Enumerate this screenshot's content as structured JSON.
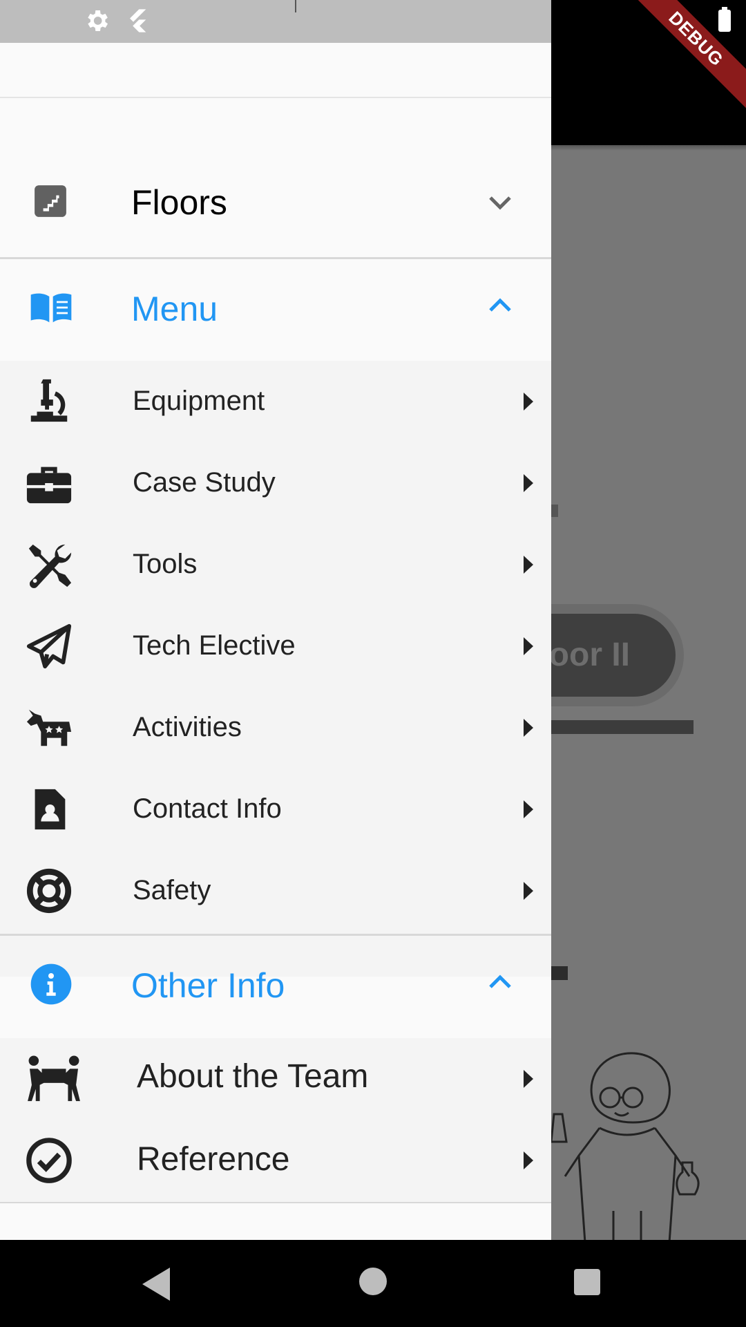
{
  "status_bar": {
    "icons": [
      "gear-icon",
      "flutter-icon",
      "battery-icon"
    ]
  },
  "debug_banner": "DEBUG",
  "background_page": {
    "button_label": "oor II"
  },
  "drawer": {
    "sections": [
      {
        "key": "floors",
        "title": "Floors",
        "icon": "stairs-icon",
        "expanded": false,
        "color": "#222222"
      },
      {
        "key": "menu",
        "title": "Menu",
        "icon": "book-open-icon",
        "expanded": true,
        "color": "#2196f3",
        "items": [
          {
            "label": "Equipment",
            "icon": "microscope-icon"
          },
          {
            "label": "Case Study",
            "icon": "briefcase-icon"
          },
          {
            "label": "Tools",
            "icon": "tools-icon"
          },
          {
            "label": "Tech Elective",
            "icon": "paper-plane-icon"
          },
          {
            "label": "Activities",
            "icon": "donkey-icon"
          },
          {
            "label": "Contact Info",
            "icon": "contact-file-icon"
          },
          {
            "label": "Safety",
            "icon": "life-ring-icon"
          }
        ]
      },
      {
        "key": "other",
        "title": "Other Info",
        "icon": "info-circle-icon",
        "expanded": true,
        "color": "#2196f3",
        "items": [
          {
            "label": "About the Team",
            "icon": "people-carry-icon"
          },
          {
            "label": "Reference",
            "icon": "check-circle-icon"
          }
        ]
      }
    ]
  },
  "nav_bar": {
    "icons": [
      "back-icon",
      "home-icon",
      "recents-icon"
    ]
  },
  "colors": {
    "accent": "#2196f3",
    "drawer_bg": "#fafafa",
    "submenu_bg": "#f4f4f4",
    "scrim": "#777777"
  }
}
